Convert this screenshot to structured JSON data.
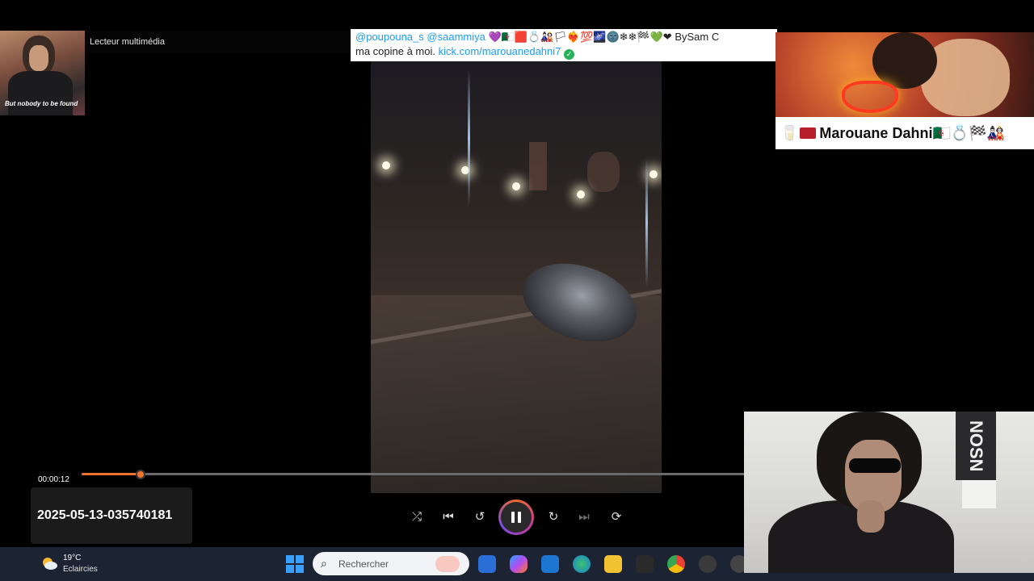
{
  "player": {
    "window_title": "Lecteur multimédia",
    "current_time": "00:00:12",
    "progress_fraction": 0.085,
    "file_name": "2025-05-13-035740181",
    "controls": {
      "shuffle": "shuffle-icon",
      "previous": "previous-track-icon",
      "rewind": "rewind-10-icon",
      "play_pause": "pause-icon",
      "forward": "forward-30-icon",
      "next": "next-track-icon",
      "repeat": "repeat-off-icon"
    },
    "accent_color": "#f0722f"
  },
  "overlay_tweet": {
    "mention1": "@poupouna_s",
    "mention2": "@saammiya",
    "emojis": "💜🇩🇿🟥💍🎎🏳❤‍🔥💯🌌🌚❄❄🏁💚❤",
    "tail": "BySam C",
    "line2_text": "ma copine à moi.",
    "link": "kick.com/marouanedahni7",
    "verified": "✓"
  },
  "avatar_top_left": {
    "caption": "But nobody to be found"
  },
  "promo": {
    "name_prefix": "🥛",
    "name": "Marouane Dahni",
    "name_suffix": "🇩🇿💍🏁🎎"
  },
  "webcam": {
    "banner_text": "NOSN"
  },
  "taskbar": {
    "weather_temp": "19°C",
    "weather_desc": "Eclaircies",
    "search_placeholder": "Rechercher",
    "background": "#1c2433"
  }
}
